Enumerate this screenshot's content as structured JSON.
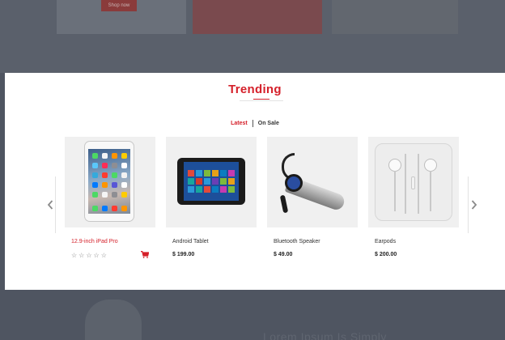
{
  "background": {
    "shop_button_label": "Shop now",
    "bottom_heading": "Lorem Ipsum Is Simply"
  },
  "section": {
    "title": "Trending"
  },
  "tabs": [
    {
      "label": "Latest",
      "active": true
    },
    {
      "label": "On Sale",
      "active": false
    }
  ],
  "navigation": {
    "prev_icon": "chevron-left-icon",
    "next_icon": "chevron-right-icon"
  },
  "products": [
    {
      "name": "12.9-inch iPad Pro",
      "price": "",
      "rating": 0,
      "max_rating": 5,
      "show_rating": true,
      "show_cart": true,
      "highlighted": true
    },
    {
      "name": "Android Tablet",
      "price": "$ 199.00"
    },
    {
      "name": "Bluetooth Speaker",
      "price": "$ 49.00"
    },
    {
      "name": "Earpods",
      "price": "$ 200.00"
    }
  ],
  "colors": {
    "accent": "#d5202a",
    "overlay": "#4f5561"
  }
}
